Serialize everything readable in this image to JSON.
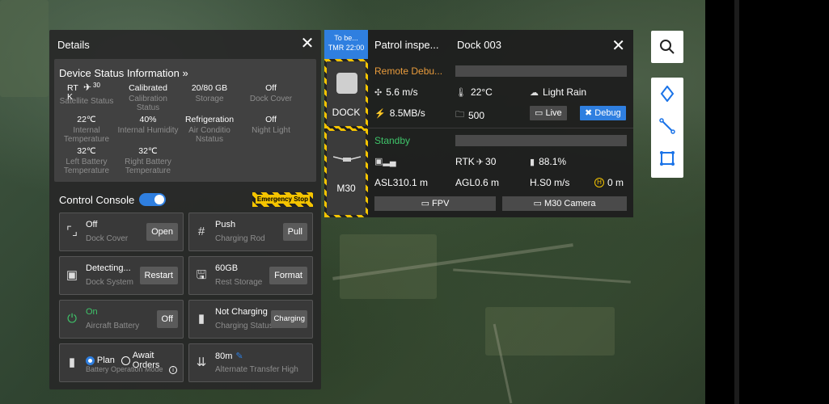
{
  "details": {
    "title": "Details",
    "status": {
      "title": "Device Status Information »",
      "rtk_top": "RT",
      "rtk_bottom": "K",
      "rtk_count": "30",
      "items": [
        {
          "value": "",
          "label": "Satellite Status"
        },
        {
          "value": "Calibrated",
          "label": "Calibration Status"
        },
        {
          "value": "20/80 GB",
          "label": "Storage"
        },
        {
          "value": "Off",
          "label": "Dock Cover"
        },
        {
          "value": "22℃",
          "label": "Internal Temperature"
        },
        {
          "value": "40%",
          "label": "Internal Humidity"
        },
        {
          "value": "Refrigeration",
          "label": "Air Conditio Nstatus"
        },
        {
          "value": "Off",
          "label": "Night Light"
        },
        {
          "value": "32℃",
          "label": "Left Battery Temperature"
        },
        {
          "value": "32℃",
          "label": "Right Battery Temperature"
        }
      ]
    },
    "console": {
      "title": "Control Console",
      "estop": "Emergency Stop",
      "cards": [
        {
          "value": "Off",
          "label": "Dock Cover",
          "button": "Open"
        },
        {
          "value": "Push",
          "label": "Charging Rod",
          "button": "Pull"
        },
        {
          "value": "Detecting...",
          "label": "Dock System",
          "button": "Restart"
        },
        {
          "value": "60GB",
          "label": "Rest Storage",
          "button": "Format"
        },
        {
          "value": "On",
          "label": "Aircraft Battery",
          "button": "Off"
        },
        {
          "value": "Not Charging",
          "label": "Charging Status",
          "button": "Charging"
        },
        {
          "value_plan": "Plan",
          "value_await": "Await Orders",
          "label": "Battery Operation Mode"
        },
        {
          "value": "80m",
          "label": "Alternate Transfer High"
        }
      ]
    }
  },
  "dock": {
    "badge_top": "To be...",
    "badge_bottom": "TMR 22:00",
    "task": "Patrol inspe...",
    "name": "Dock 003",
    "dock_device": {
      "name": "DOCK",
      "state": "Remote Debu...",
      "wind": "5.6 m/s",
      "temp": "22°C",
      "weather": "Light Rain",
      "net": "8.5MB/s",
      "count": "500",
      "live": "Live",
      "debug": "Debug"
    },
    "drone_device": {
      "name": "M30",
      "state": "Standby",
      "rtk_label": "RTK",
      "rtk": "30",
      "battery": "88.1%",
      "asl_label": "ASL",
      "asl": "310.1 m",
      "agl_label": "AGL",
      "agl": "0.6 m",
      "hs_label": "H.S",
      "hs": "0 m/s",
      "h": "0 m",
      "fpv": "FPV",
      "camera": "M30 Camera"
    }
  },
  "colors": {
    "accent": "#2f7fe0",
    "warning": "#f5c400",
    "ok": "#3fc46a",
    "debug_state": "#e89b3c"
  }
}
